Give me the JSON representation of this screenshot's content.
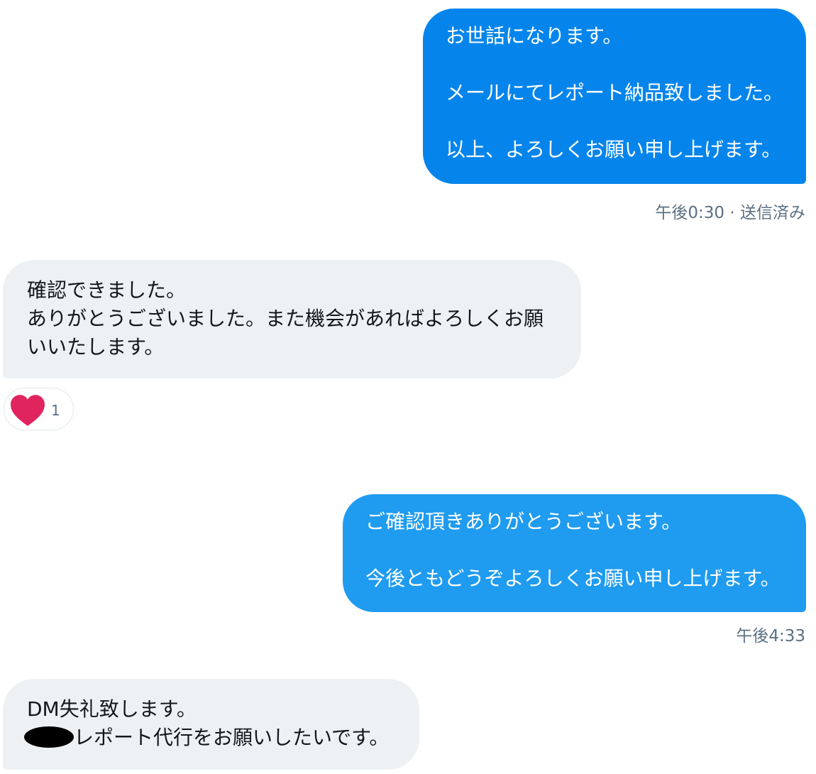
{
  "messages": [
    {
      "direction": "sent",
      "text": "お世話になります。\n\nメールにてレポート納品致しました。\n\n以上、よろしくお願い申し上げます。",
      "timestamp": "午後0:30",
      "status": "送信済み"
    },
    {
      "direction": "received",
      "text": "確認できました。\nありがとうございました。また機会があればよろしくお願いいたします。",
      "reaction": {
        "icon": "heart-icon",
        "count": "1"
      }
    },
    {
      "direction": "sent",
      "text": "ご確認頂きありがとうございます。\n\n今後ともどうぞよろしくお願い申し上げます。",
      "timestamp": "午後4:33"
    },
    {
      "direction": "received",
      "line1": "DM失礼致します。",
      "line2": "レポート代行をお願いしたいです。"
    }
  ],
  "colors": {
    "sent_bubble_primary": "#0585ec",
    "sent_bubble_secondary": "#1f9bf0",
    "received_bubble": "#eef1f3",
    "heart": "#e0245e",
    "meta_text": "#5b7083"
  }
}
